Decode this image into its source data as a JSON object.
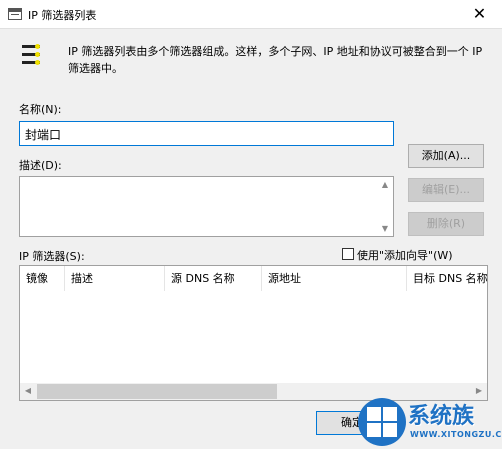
{
  "window": {
    "title": "IP 筛选器列表",
    "close_glyph": "✕",
    "icon": "window-icon"
  },
  "intro": {
    "icon": "filter-list-icon",
    "text_line1": "IP 筛选器列表由多个筛选器组成。这样，多个子网、IP 地址和协议可被整合到一个 IP",
    "text_line2": "筛选器中。"
  },
  "form": {
    "name_label": "名称(N):",
    "name_value": "封端口",
    "description_label": "描述(D):",
    "description_value": ""
  },
  "buttons": {
    "add": "添加(A)...",
    "edit": "编辑(E)...",
    "delete": "删除(R)",
    "ok": "确定"
  },
  "filters": {
    "label": "IP 筛选器(S):",
    "wizard_checkbox_label": "使用\"添加向导\"(W)",
    "wizard_checked": false,
    "columns": [
      "镜像",
      "描述",
      "源 DNS 名称",
      "源地址",
      "目标 DNS 名称"
    ],
    "rows": []
  },
  "watermark": {
    "text": "系统族",
    "url": "WWW.XITONGZU.COM",
    "brand_color": "#1f72c4"
  }
}
